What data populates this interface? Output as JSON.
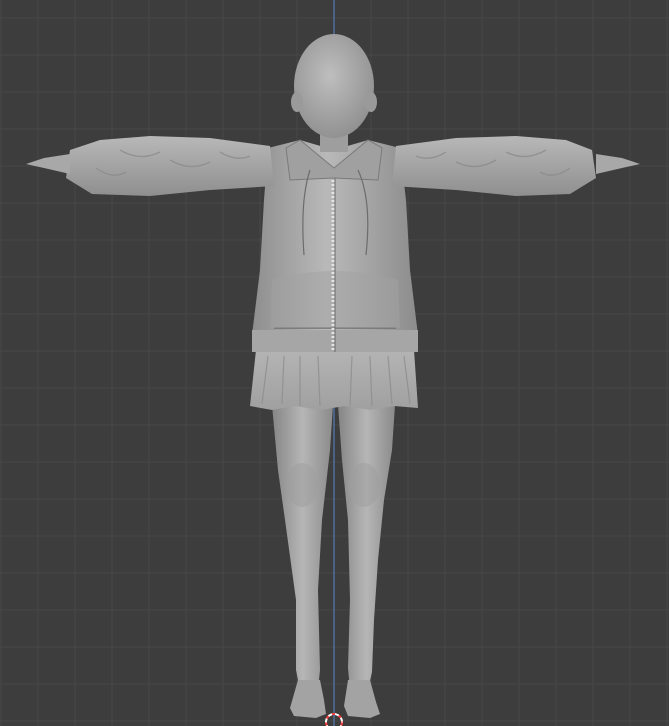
{
  "viewport": {
    "background": "#3d3d3d",
    "grid_minor": "#474747",
    "grid_major": "#505050",
    "axis_z": "#5a86c8",
    "axis_x": "#b44646"
  },
  "model": {
    "base": "#a9a9a9",
    "light": "#bdbdbd",
    "shade": "#8a8a8a",
    "dark": "#6e6e6e",
    "edge": "#5c5c5c"
  },
  "origin_marker": {
    "color_a": "#ff3b3b",
    "color_b": "#ffffff"
  }
}
